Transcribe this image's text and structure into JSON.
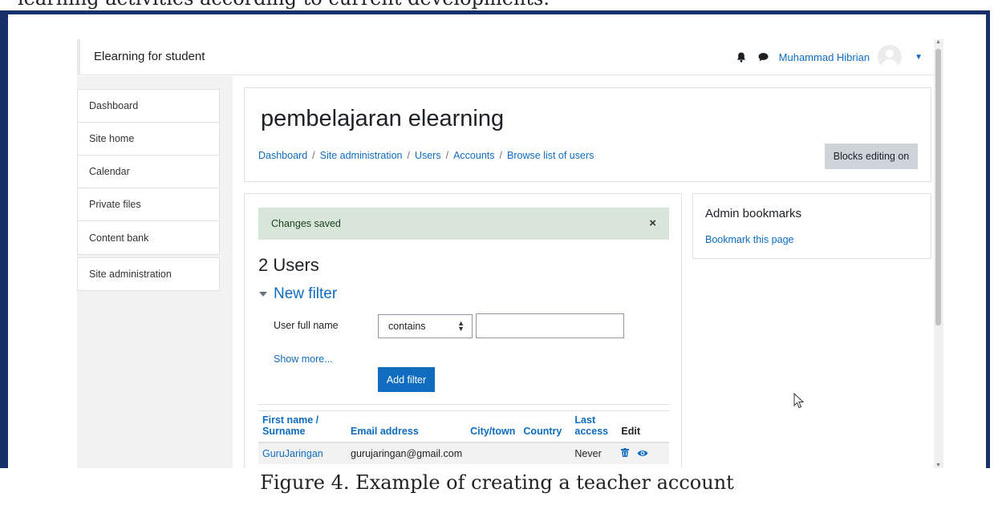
{
  "doc": {
    "top_text": "learning activities according to current developments.",
    "caption": "Figure 4. Example of creating a teacher account"
  },
  "navbar": {
    "brand": "Elearning for student",
    "user_name": "Muhammad Hibrian"
  },
  "drawer": {
    "items": [
      "Dashboard",
      "Site home",
      "Calendar",
      "Private files",
      "Content bank"
    ],
    "admin_item": "Site administration"
  },
  "header": {
    "title": "pembelajaran elearning",
    "breadcrumb": [
      "Dashboard",
      "Site administration",
      "Users",
      "Accounts",
      "Browse list of users"
    ],
    "blocks_button": "Blocks editing on"
  },
  "main": {
    "alert": "Changes saved",
    "alert_close": "×",
    "users_heading": "2 Users",
    "filter_legend": "New filter",
    "filter_label": "User full name",
    "filter_select": "contains",
    "filter_value": "",
    "show_more": "Show more...",
    "add_filter": "Add filter",
    "table": {
      "headers": [
        "First name / Surname",
        "Email address",
        "City/town",
        "Country",
        "Last access",
        "Edit"
      ],
      "rows": [
        {
          "name": "GuruJaringan",
          "email": "gurujaringan@gmail.com",
          "city": "",
          "country": "",
          "last_access": "Never"
        }
      ]
    }
  },
  "side": {
    "title": "Admin bookmarks",
    "link": "Bookmark this page"
  },
  "colors": {
    "frame": "#17306b",
    "link": "#0f6cbf",
    "alert_bg": "#d7e6d8",
    "button_primary": "#0f6cbf"
  }
}
